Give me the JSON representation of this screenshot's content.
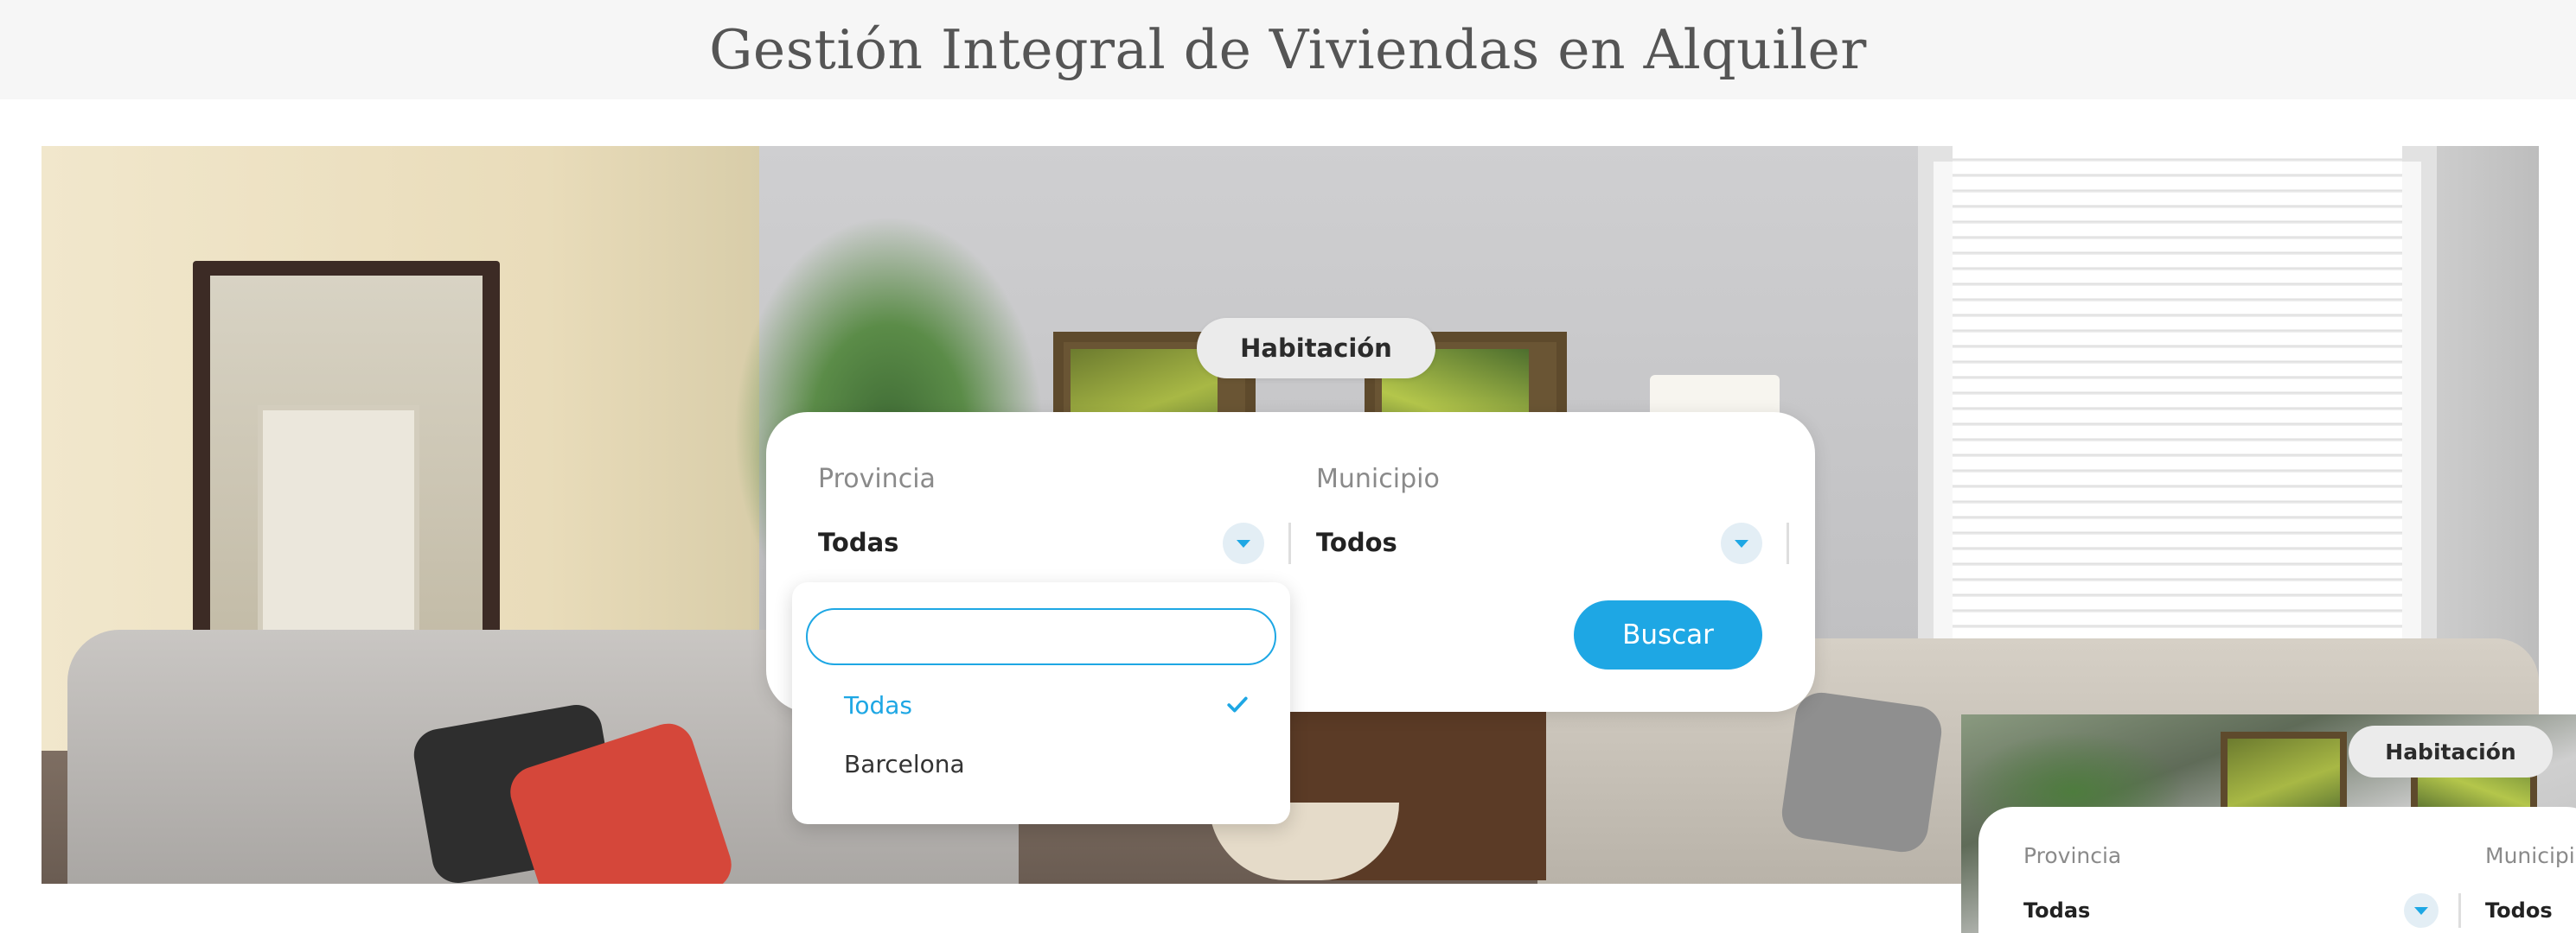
{
  "page": {
    "title": "Gestión Integral de Viviendas en Alquiler"
  },
  "search": {
    "tab_label": "Habitación",
    "provincia": {
      "label": "Provincia",
      "value": "Todas"
    },
    "municipio": {
      "label": "Municipio",
      "value": "Todos"
    },
    "buscar_label": "Buscar"
  },
  "dropdown": {
    "search_value": "",
    "options": [
      {
        "label": "Todas",
        "selected": true
      },
      {
        "label": "Barcelona",
        "selected": false
      }
    ]
  },
  "preview": {
    "tab_label": "Habitación",
    "provincia": {
      "label": "Provincia",
      "value": "Todas"
    },
    "municipio": {
      "label": "Municipio",
      "value": "Todos"
    }
  },
  "colors": {
    "accent": "#1ea7e4",
    "header_bg": "#f6f6f6",
    "title": "#555555"
  },
  "icons": {
    "dropdown_toggle": "caret-down-icon",
    "selected_marker": "check-icon"
  }
}
